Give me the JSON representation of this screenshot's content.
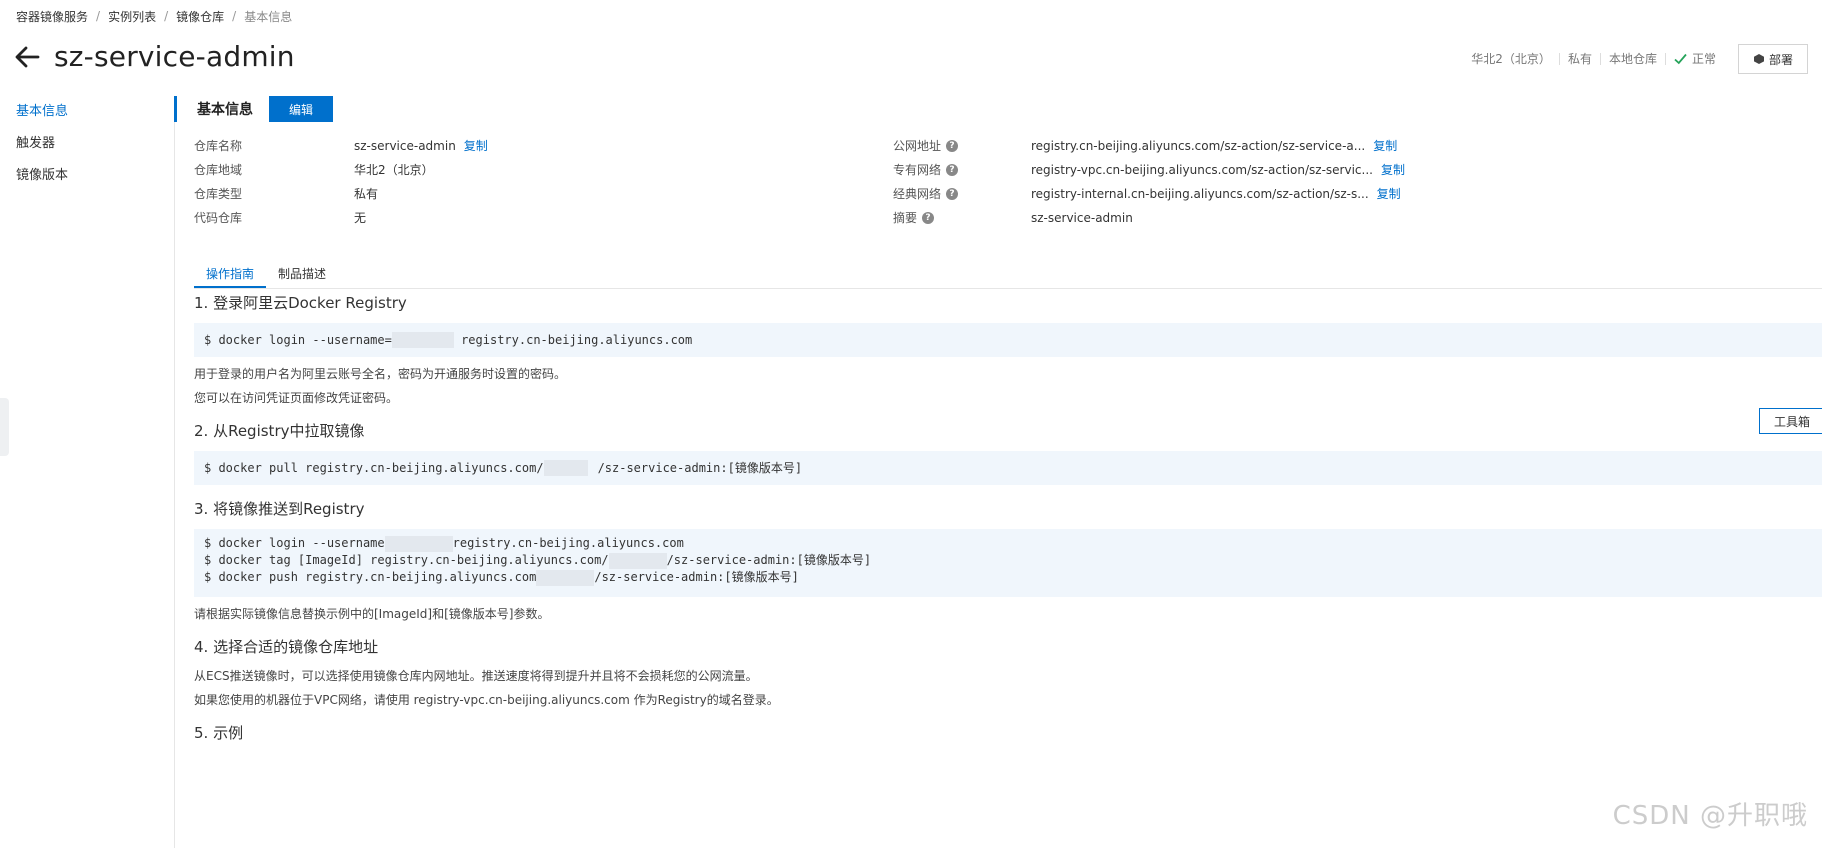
{
  "breadcrumb": [
    "容器镜像服务",
    "实例列表",
    "镜像仓库",
    "基本信息"
  ],
  "breadcrumb_sep": "/",
  "title": "sz-service-admin",
  "header": {
    "region": "华北2（北京）",
    "type": "私有",
    "source": "本地仓库",
    "status": "正常",
    "deploy_label": "部署",
    "status_color": "#25a35a"
  },
  "sidebar": {
    "items": [
      {
        "label": "基本信息",
        "active": true
      },
      {
        "label": "触发器",
        "active": false
      },
      {
        "label": "镜像版本",
        "active": false
      }
    ]
  },
  "section": {
    "title": "基本信息",
    "edit_label": "编辑"
  },
  "info": {
    "copy_label": "复制",
    "left": [
      {
        "label": "仓库名称",
        "value": "sz-service-admin"
      },
      {
        "label": "仓库地域",
        "value": "华北2（北京）"
      },
      {
        "label": "仓库类型",
        "value": "私有"
      },
      {
        "label": "代码仓库",
        "value": "无"
      }
    ],
    "right": [
      {
        "label": "公网地址",
        "value": "registry.cn-beijing.aliyuncs.com/sz-action/sz-service-a..."
      },
      {
        "label": "专有网络",
        "value": "registry-vpc.cn-beijing.aliyuncs.com/sz-action/sz-servic..."
      },
      {
        "label": "经典网络",
        "value": "registry-internal.cn-beijing.aliyuncs.com/sz-action/sz-s..."
      },
      {
        "label": "摘要",
        "value": "sz-service-admin"
      }
    ]
  },
  "tabs": [
    {
      "label": "操作指南",
      "active": true
    },
    {
      "label": "制品描述",
      "active": false
    }
  ],
  "guide": {
    "s1": {
      "heading": "1. 登录阿里云Docker Registry",
      "code_a": "$ docker login --username=",
      "code_b": " registry.cn-beijing.aliyuncs.com",
      "p1": "用于登录的用户名为阿里云账号全名，密码为开通服务时设置的密码。",
      "p2": "您可以在访问凭证页面修改凭证密码。"
    },
    "s2": {
      "heading": "2. 从Registry中拉取镜像",
      "code_a": "$ docker pull registry.cn-beijing.aliyuncs.com/",
      "code_b": "/sz-service-admin:[镜像版本号]"
    },
    "s3": {
      "heading": "3. 将镜像推送到Registry",
      "l1a": "$ docker login --username",
      "l1b": "registry.cn-beijing.aliyuncs.com",
      "l2a": "$ docker tag [ImageId] registry.cn-beijing.aliyuncs.com/",
      "l2b": "/sz-service-admin:[镜像版本号]",
      "l3a": "$ docker push registry.cn-beijing.aliyuncs.com",
      "l3b": "/sz-service-admin:[镜像版本号]",
      "p1": "请根据实际镜像信息替换示例中的[ImageId]和[镜像版本号]参数。"
    },
    "s4": {
      "heading": "4. 选择合适的镜像仓库地址",
      "p1": "从ECS推送镜像时，可以选择使用镜像仓库内网地址。推送速度将得到提升并且将不会损耗您的公网流量。",
      "p2": "如果您使用的机器位于VPC网络，请使用 registry-vpc.cn-beijing.aliyuncs.com 作为Registry的域名登录。"
    },
    "s5": {
      "heading": "5. 示例"
    }
  },
  "toolbox_label": "工具箱",
  "watermark": "CSDN @升职哦"
}
